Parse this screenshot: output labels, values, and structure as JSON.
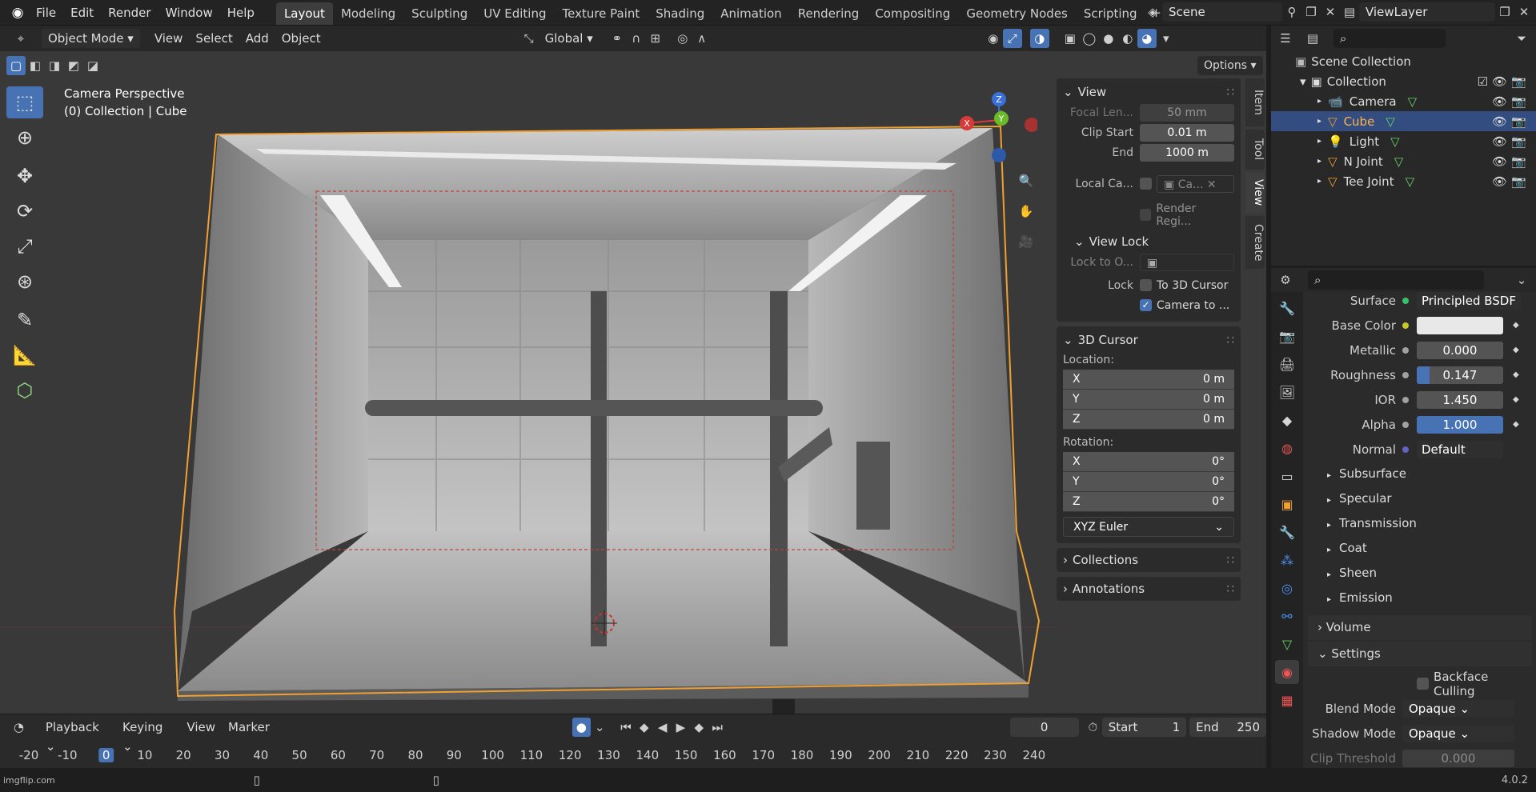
{
  "menu": [
    "File",
    "Edit",
    "Render",
    "Window",
    "Help"
  ],
  "workspaces": [
    "Layout",
    "Modeling",
    "Sculpting",
    "UV Editing",
    "Texture Paint",
    "Shading",
    "Animation",
    "Rendering",
    "Compositing",
    "Geometry Nodes",
    "Scripting"
  ],
  "active_workspace": "Layout",
  "scene": "Scene",
  "view_layer": "ViewLayer",
  "viewport_header": {
    "mode": "Object Mode",
    "menus": [
      "View",
      "Select",
      "Add",
      "Object"
    ],
    "transform": "Global",
    "options": "Options"
  },
  "overlay_text": {
    "line1": "Camera Perspective",
    "line2": "(0) Collection | Cube"
  },
  "gizmo": {
    "x": "X",
    "y": "Y",
    "z": "Z"
  },
  "npanel": {
    "view": {
      "title": "View",
      "focal_label": "Focal Len...",
      "focal": "50 mm",
      "clip_start_label": "Clip Start",
      "clip_start": "0.01 m",
      "end_label": "End",
      "end": "1000 m",
      "local_cam_label": "Local Ca...",
      "local_cam_value": "Ca...",
      "render_region": "Render Regi..."
    },
    "view_lock": {
      "title": "View Lock",
      "lock_obj_label": "Lock to O...",
      "lock_label": "Lock",
      "to_cursor": "To 3D Cursor",
      "camera_to": "Camera to ..."
    },
    "cursor": {
      "title": "3D Cursor",
      "location": "Location:",
      "loc": [
        [
          "X",
          "0 m"
        ],
        [
          "Y",
          "0 m"
        ],
        [
          "Z",
          "0 m"
        ]
      ],
      "rotation": "Rotation:",
      "rot": [
        [
          "X",
          "0°"
        ],
        [
          "Y",
          "0°"
        ],
        [
          "Z",
          "0°"
        ]
      ],
      "mode": "XYZ Euler"
    },
    "collections": "Collections",
    "annotations": "Annotations"
  },
  "side_tabs": [
    "Item",
    "Tool",
    "View",
    "Create"
  ],
  "outliner": {
    "root": "Scene Collection",
    "collection": "Collection",
    "items": [
      "Camera",
      "Cube",
      "Light",
      "N Joint",
      "Tee Joint"
    ],
    "selected": "Cube"
  },
  "material": {
    "surface_label": "Surface",
    "surface": "Principled BSDF",
    "rows": [
      {
        "label": "Base Color",
        "value": "",
        "color": "#e8e8e8",
        "socket": "#c7c729"
      },
      {
        "label": "Metallic",
        "value": "0.000",
        "socket": "#a1a1a1"
      },
      {
        "label": "Roughness",
        "value": "0.147",
        "fill": 0.147,
        "socket": "#a1a1a1"
      },
      {
        "label": "IOR",
        "value": "1.450",
        "socket": "#a1a1a1"
      },
      {
        "label": "Alpha",
        "value": "1.000",
        "fill": 1.0,
        "socket": "#a1a1a1"
      },
      {
        "label": "Normal",
        "value": "Default",
        "socket": "#6363c7"
      }
    ],
    "subsections": [
      "Subsurface",
      "Specular",
      "Transmission",
      "Coat",
      "Sheen",
      "Emission"
    ],
    "volume": "Volume",
    "settings": "Settings",
    "backface": "Backface Culling",
    "blend_label": "Blend Mode",
    "blend": "Opaque",
    "shadow_label": "Shadow Mode",
    "shadow": "Opaque",
    "clip_label": "Clip Threshold",
    "clip": "0.000"
  },
  "timeline": {
    "menus": [
      "Playback",
      "Keying",
      "View",
      "Marker"
    ],
    "frame": "0",
    "start_label": "Start",
    "start": "1",
    "end_label": "End",
    "end": "250",
    "ticks": [
      "-20",
      "-10",
      "0",
      "10",
      "20",
      "30",
      "40",
      "50",
      "60",
      "70",
      "80",
      "90",
      "100",
      "110",
      "120",
      "130",
      "140",
      "150",
      "160",
      "170",
      "180",
      "190",
      "200",
      "210",
      "220",
      "230",
      "240"
    ],
    "current": "0"
  },
  "status": {
    "version": "4.0.2",
    "watermark": "imgflip.com"
  },
  "colors": {
    "accent": "#4772b3",
    "selection_orange": "#f0a030",
    "bg": "#393939"
  }
}
